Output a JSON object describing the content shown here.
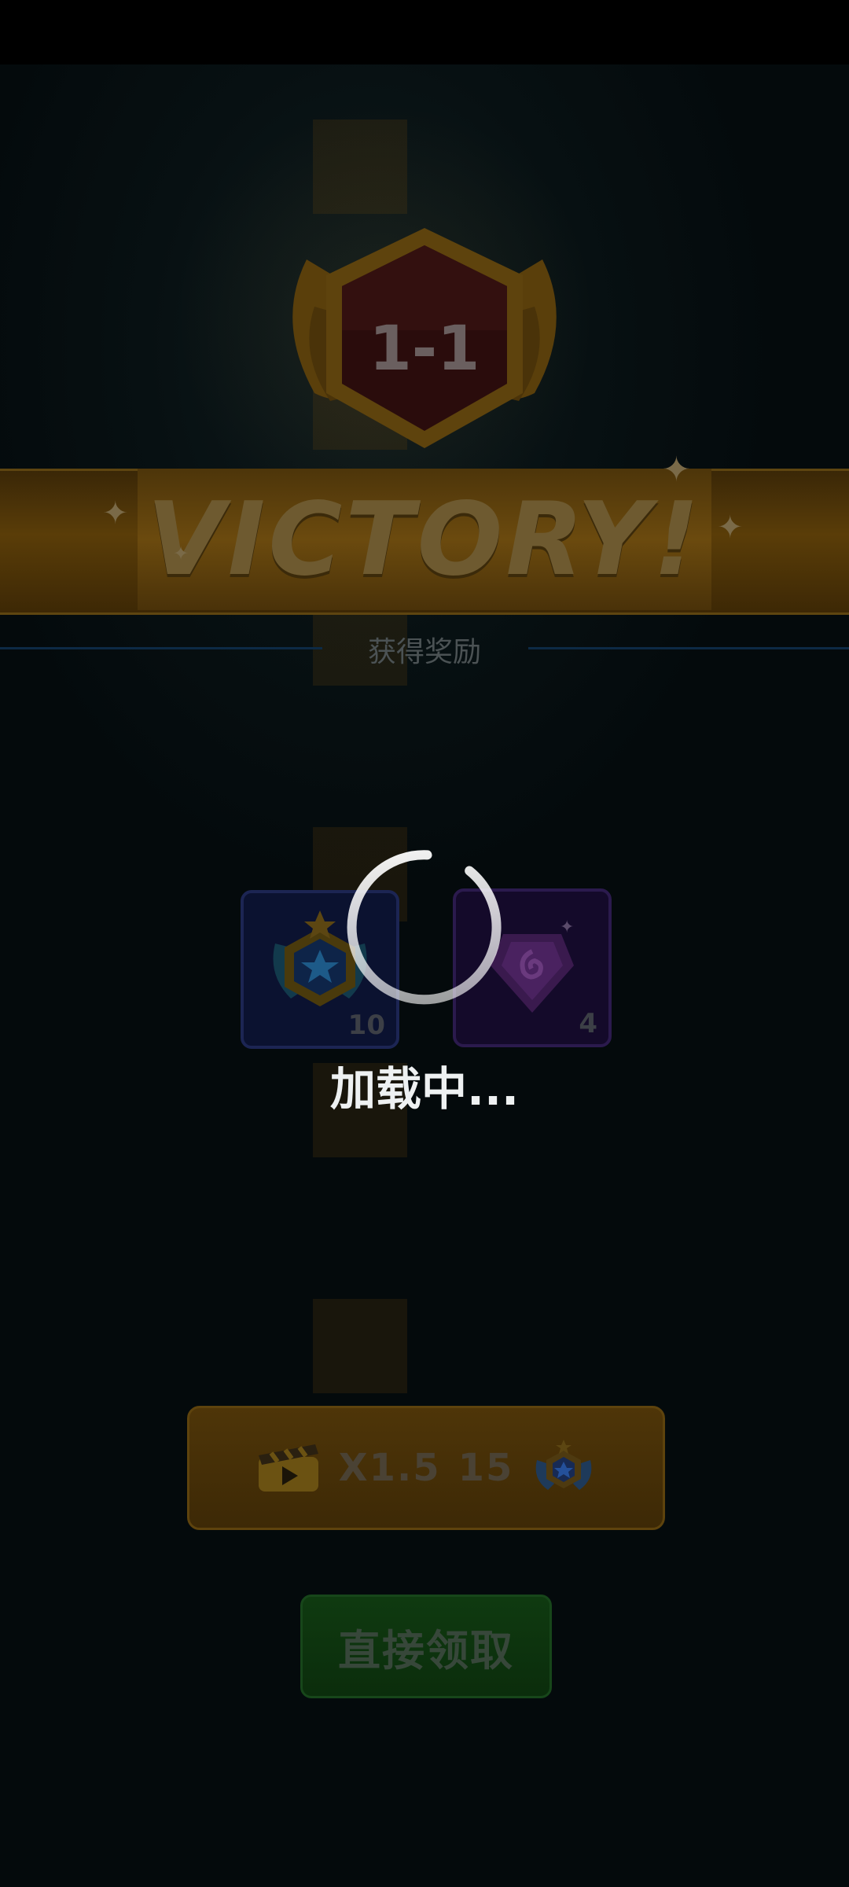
{
  "level": {
    "label": "1-1"
  },
  "result": {
    "title": "VICTORY!"
  },
  "rewards": {
    "title": "获得奖励",
    "items": [
      {
        "icon": "star-medal-icon",
        "count": "10"
      },
      {
        "icon": "purple-gem-icon",
        "count": "4"
      }
    ]
  },
  "loading": {
    "text": "加载中..."
  },
  "buttons": {
    "video_multiplier": "X1.5",
    "video_amount": "15",
    "claim_direct": "直接领取"
  },
  "colors": {
    "gold": "#6b4a0e",
    "green": "#0f3a10",
    "spinner": "#ffffff"
  }
}
